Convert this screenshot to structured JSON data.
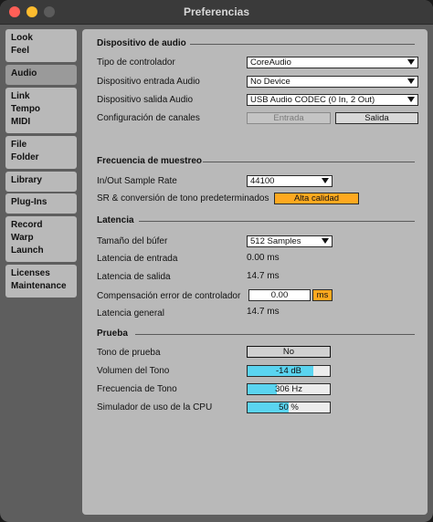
{
  "window": {
    "title": "Preferencias"
  },
  "sidebar": {
    "groups": [
      {
        "items": [
          "Look",
          "Feel"
        ]
      },
      {
        "items": [
          "Audio"
        ]
      },
      {
        "items": [
          "Link",
          "Tempo",
          "MIDI"
        ]
      },
      {
        "items": [
          "File",
          "Folder"
        ]
      },
      {
        "items": [
          "Library"
        ]
      },
      {
        "items": [
          "Plug-Ins"
        ]
      },
      {
        "items": [
          "Record",
          "Warp",
          "Launch"
        ]
      },
      {
        "items": [
          "Licenses",
          "Maintenance"
        ]
      }
    ],
    "active": "Audio"
  },
  "audio_device": {
    "title": "Dispositivo de audio",
    "driver_label": "Tipo de controlador",
    "driver_value": "CoreAudio",
    "input_label": "Dispositivo entrada Audio",
    "input_value": "No Device",
    "output_label": "Dispositivo salida Audio",
    "output_value": "USB Audio CODEC  (0 In, 2 Out)",
    "channels_label": "Configuración de canales",
    "input_btn": "Entrada",
    "output_btn": "Salida"
  },
  "sample_rate": {
    "title": "Frecuencia de muestreo",
    "rate_label": "In/Out Sample Rate",
    "rate_value": "44100",
    "src_label": "SR & conversión de tono predeterminados",
    "src_value": "Alta calidad"
  },
  "latency": {
    "title": "Latencia",
    "buffer_label": "Tamaño del búfer",
    "buffer_value": "512 Samples",
    "in_label": "Latencia de entrada",
    "in_value": "0.00 ms",
    "out_label": "Latencia de salida",
    "out_value": "14.7 ms",
    "comp_label": "Compensación error de controlador",
    "comp_value": "0.00",
    "comp_unit": "ms",
    "total_label": "Latencia general",
    "total_value": "14.7 ms"
  },
  "test": {
    "title": "Prueba",
    "tone_label": "Tono de prueba",
    "tone_value": "No",
    "volume_label": "Volumen del Tono",
    "volume_value": "-14 dB",
    "volume_level": 0.8,
    "freq_label": "Frecuencia de Tono",
    "freq_value": "306 Hz",
    "freq_level": 0.35,
    "cpu_label": "Simulador de uso de la CPU",
    "cpu_value": "50 %",
    "cpu_level": 0.5
  },
  "colors": {
    "accent_orange": "#ffa91f",
    "meter_blue": "#5ad4f0",
    "panel": "#b9b9b9"
  }
}
